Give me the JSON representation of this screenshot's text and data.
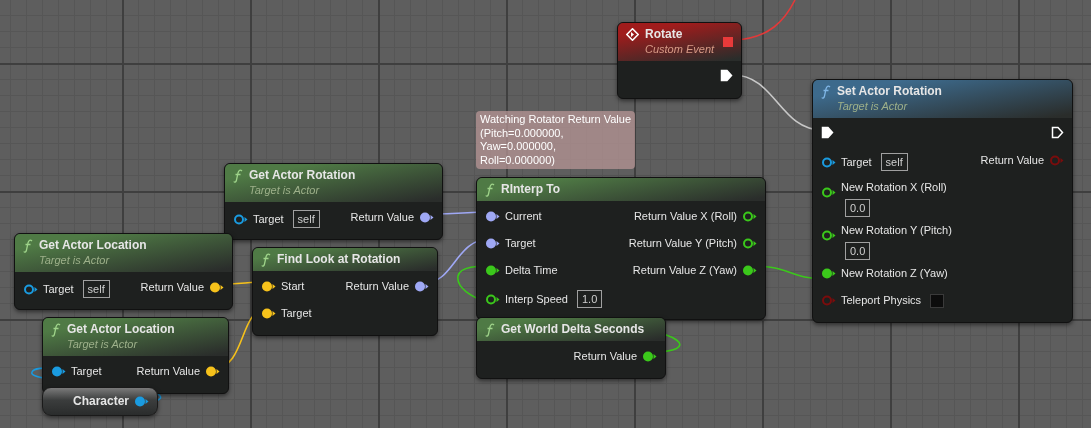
{
  "nodes": [
    {
      "kind": "event",
      "title": "Rotate",
      "subtitle": "Custom Event",
      "color": "#a01c1c",
      "rows": [
        {
          "output": {
            "kind": "exec",
            "color": "#ffffff",
            "connected": true
          }
        }
      ]
    },
    {
      "kind": "function",
      "title": "Set Actor Rotation",
      "subtitle": "Target is Actor",
      "color": "#3d6a8c",
      "rows": [
        {
          "input": {
            "kind": "exec",
            "color": "#ffffff",
            "connected": true
          },
          "output": {
            "kind": "exec",
            "color": "#ffffff",
            "connected": false
          }
        },
        {
          "input": {
            "kind": "data",
            "label": "Target",
            "value": "self",
            "color": "#1a9be0",
            "connected": false
          },
          "output": {
            "kind": "data",
            "label": "Return Value",
            "color": "#7a0c0c",
            "connected": false
          }
        },
        {
          "input": {
            "kind": "stacked",
            "label": "New Rotation X (Roll)",
            "value": "0.0",
            "color": "#3bc81b",
            "connected": false
          }
        },
        {
          "input": {
            "kind": "stacked",
            "label": "New Rotation Y (Pitch)",
            "value": "0.0",
            "color": "#3bc81b",
            "connected": false
          }
        },
        {
          "input": {
            "kind": "data",
            "label": "New Rotation Z (Yaw)",
            "color": "#3bc81b",
            "connected": true
          }
        },
        {
          "input": {
            "kind": "checkbox",
            "label": "Teleport Physics",
            "checked": false,
            "color": "#7a0c0c",
            "connected": false
          }
        }
      ]
    },
    {
      "kind": "watch",
      "text": "Watching Rotator Return Value\n(Pitch=0.000000,\nYaw=0.000000,\nRoll=0.000000)"
    },
    {
      "kind": "function",
      "title": "Get Actor Rotation",
      "subtitle": "Target is Actor",
      "color": "#4f7a45",
      "rows": [
        {
          "input": {
            "kind": "data",
            "label": "Target",
            "value": "self",
            "color": "#1a9be0",
            "connected": false
          },
          "output": {
            "kind": "data",
            "label": "Return Value",
            "color": "#9fa8f5",
            "connected": true
          }
        }
      ]
    },
    {
      "kind": "function",
      "title": "RInterp To",
      "color": "#4f7a45",
      "rows": [
        {
          "input": {
            "kind": "data",
            "label": "Current",
            "color": "#9fa8f5",
            "connected": true
          },
          "output": {
            "kind": "data",
            "label": "Return Value X (Roll)",
            "color": "#3bc81b",
            "connected": false
          }
        },
        {
          "input": {
            "kind": "data",
            "label": "Target",
            "color": "#9fa8f5",
            "connected": true
          },
          "output": {
            "kind": "data",
            "label": "Return Value Y (Pitch)",
            "color": "#3bc81b",
            "connected": false
          }
        },
        {
          "input": {
            "kind": "data",
            "label": "Delta Time",
            "color": "#3bc81b",
            "connected": true
          },
          "output": {
            "kind": "data",
            "label": "Return Value Z (Yaw)",
            "color": "#3bc81b",
            "connected": true
          }
        },
        {
          "input": {
            "kind": "data",
            "label": "Interp Speed",
            "value": "1.0",
            "color": "#3bc81b",
            "connected": false
          }
        }
      ]
    },
    {
      "kind": "function",
      "title": "Get Actor Location",
      "subtitle": "Target is Actor",
      "color": "#4f7a45",
      "rows": [
        {
          "input": {
            "kind": "data",
            "label": "Target",
            "value": "self",
            "color": "#1a9be0",
            "connected": false
          },
          "output": {
            "kind": "data",
            "label": "Return Value",
            "color": "#f7c21b",
            "connected": true
          }
        }
      ]
    },
    {
      "kind": "function",
      "title": "Find Look at Rotation",
      "color": "#4f7a45",
      "rows": [
        {
          "input": {
            "kind": "data",
            "label": "Start",
            "color": "#f7c21b",
            "connected": true
          },
          "output": {
            "kind": "data",
            "label": "Return Value",
            "color": "#9fa8f5",
            "connected": true
          }
        },
        {
          "input": {
            "kind": "data",
            "label": "Target",
            "color": "#f7c21b",
            "connected": true
          }
        }
      ]
    },
    {
      "kind": "function",
      "title": "Get Actor Location",
      "subtitle": "Target is Actor",
      "color": "#4f7a45",
      "rows": [
        {
          "input": {
            "kind": "data",
            "label": "Target",
            "color": "#1a9be0",
            "connected": true
          },
          "output": {
            "kind": "data",
            "label": "Return Value",
            "color": "#f7c21b",
            "connected": true
          }
        }
      ]
    },
    {
      "kind": "function",
      "title": "Get World Delta Seconds",
      "color": "#4f7a45",
      "rows": [
        {
          "output": {
            "kind": "data",
            "label": "Return Value",
            "color": "#3bc81b",
            "connected": true
          }
        }
      ]
    },
    {
      "kind": "variable",
      "title": "Character",
      "rows": [
        {
          "output": {
            "kind": "data",
            "color": "#1a9be0",
            "connected": true
          }
        }
      ]
    }
  ]
}
